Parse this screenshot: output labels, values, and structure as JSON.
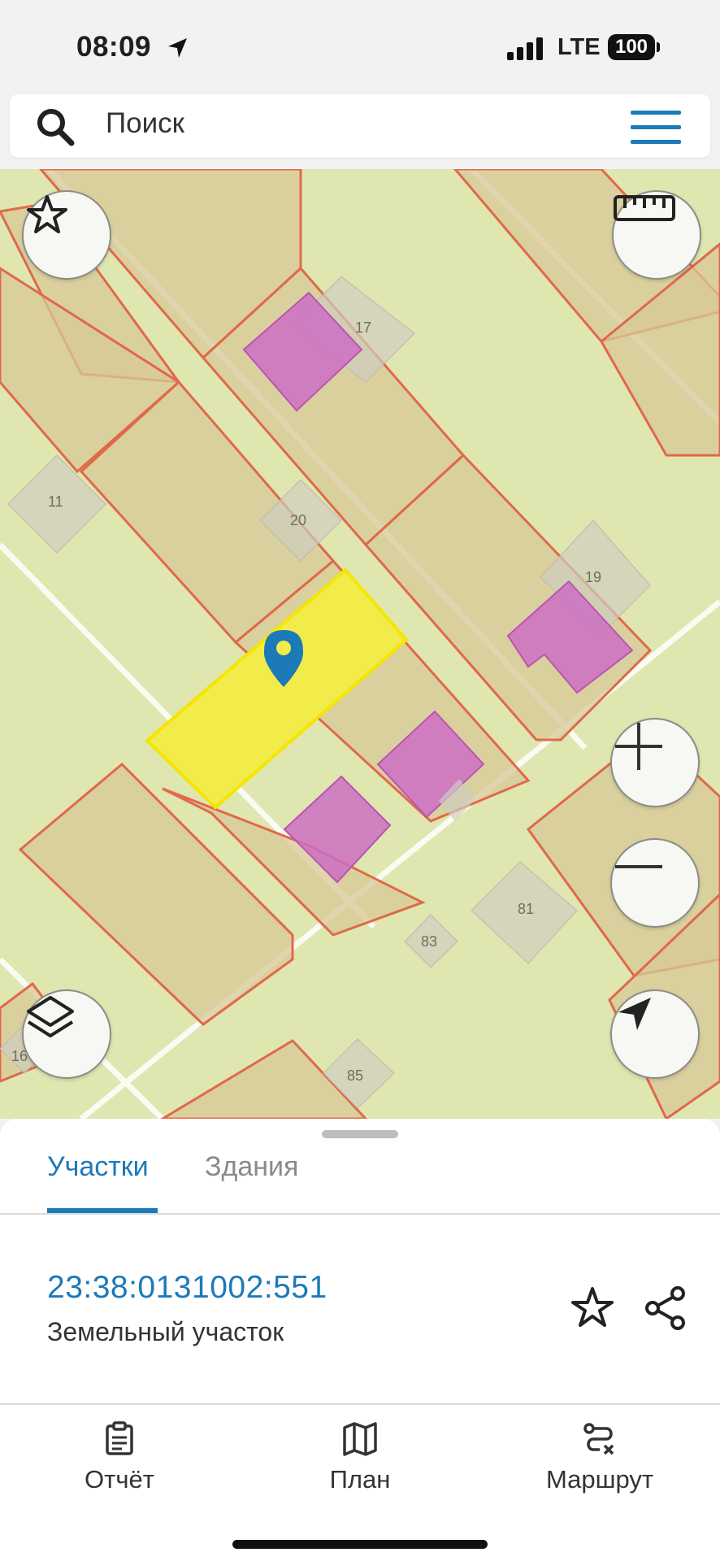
{
  "status_bar": {
    "time": "08:09",
    "network": "LTE",
    "battery": "100"
  },
  "search": {
    "placeholder": "Поиск"
  },
  "map": {
    "parcel_numbers": [
      "17",
      "11",
      "20",
      "19",
      "81",
      "83",
      "16",
      "85"
    ],
    "colors": {
      "background": "#dfe6b0",
      "parcel_fill": "#d8c898",
      "parcel_border": "#e0694a",
      "building": "#cc6fc3",
      "selected_parcel": "#f2ec4a",
      "marker": "#1c7ab9"
    }
  },
  "map_controls": {
    "favorites": "star-icon",
    "ruler": "ruler-icon",
    "zoom_in": "plus-icon",
    "zoom_out": "minus-icon",
    "layers": "layers-icon",
    "locate": "navigation-arrow-icon"
  },
  "sheet": {
    "tabs": [
      {
        "label": "Участки",
        "active": true
      },
      {
        "label": "Здания",
        "active": false
      }
    ],
    "result": {
      "cadastral_number": "23:38:0131002:551",
      "type": "Земельный участок"
    }
  },
  "bottom_nav": {
    "items": [
      {
        "label": "Отчёт",
        "icon": "clipboard-icon"
      },
      {
        "label": "План",
        "icon": "map-icon"
      },
      {
        "label": "Маршрут",
        "icon": "route-icon"
      }
    ]
  },
  "accent_color": "#1c7ab9"
}
